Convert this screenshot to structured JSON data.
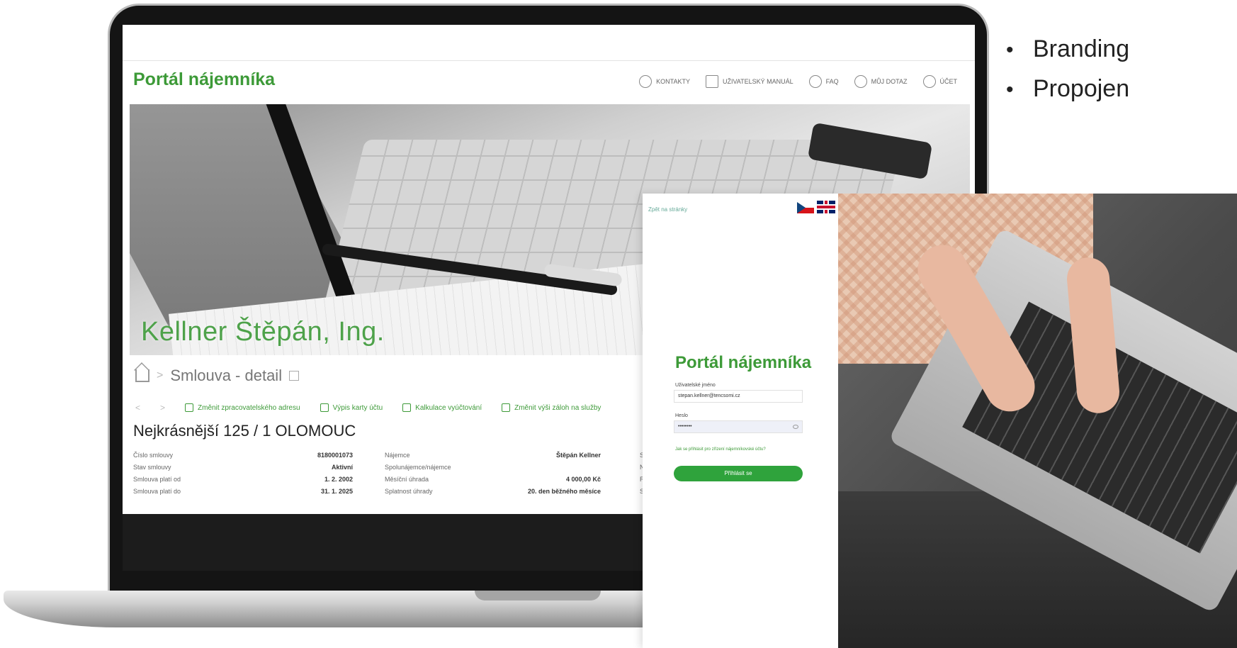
{
  "bullets": [
    "Branding",
    "Propojen"
  ],
  "portal": {
    "logo": "Portál nájemníka",
    "nav": [
      {
        "icon": "phone-icon",
        "label": "KONTAKTY"
      },
      {
        "icon": "manual-icon",
        "label": "UŽIVATELSKÝ MANUÁL"
      },
      {
        "icon": "faq-icon",
        "label": "FAQ"
      },
      {
        "icon": "chat-icon",
        "label": "MŮJ DOTAZ"
      },
      {
        "icon": "account-icon",
        "label": "ÚČET"
      }
    ],
    "hero_name": "Kellner Štěpán, Ing.",
    "breadcrumb": {
      "page": "Smlouva - detail"
    },
    "actions": [
      "Změnit zpracovatelského adresu",
      "Výpis karty účtu",
      "Kalkulace vyúčtování",
      "Změnit výši záloh na služby"
    ],
    "address": "Nejkrásnější 125 / 1 OLOMOUC",
    "details_col1": [
      {
        "label": "Číslo smlouvy",
        "value": "8180001073"
      },
      {
        "label": "Stav smlouvy",
        "value": "Aktivní"
      },
      {
        "label": "Smlouva platí od",
        "value": "1. 2. 2002"
      },
      {
        "label": "Smlouva platí do",
        "value": "31. 1. 2025"
      }
    ],
    "details_col2": [
      {
        "label": "Nájemce",
        "value": "Štěpán Kellner"
      },
      {
        "label": "Spolunájemce/nájemce",
        "value": ""
      },
      {
        "label": "Měsíční úhrada",
        "value": "4 000,00 Kč"
      },
      {
        "label": "Splatnost úhrady",
        "value": "20. den běžného měsíce"
      }
    ],
    "details_col3": [
      "Sl",
      "Ná",
      "Ro",
      "Sl"
    ]
  },
  "login": {
    "back": "Zpět na stránky",
    "title": "Portál nájemníka",
    "username_label": "Uživatelské jméno",
    "username_value": "stepan.kellner@tencsomi.cz",
    "password_label": "Heslo",
    "password_value": "••••••••",
    "forgot": "Jak se přihlásit pro zřízení nájemníkovské účtu?",
    "button": "Přihlásit se"
  }
}
